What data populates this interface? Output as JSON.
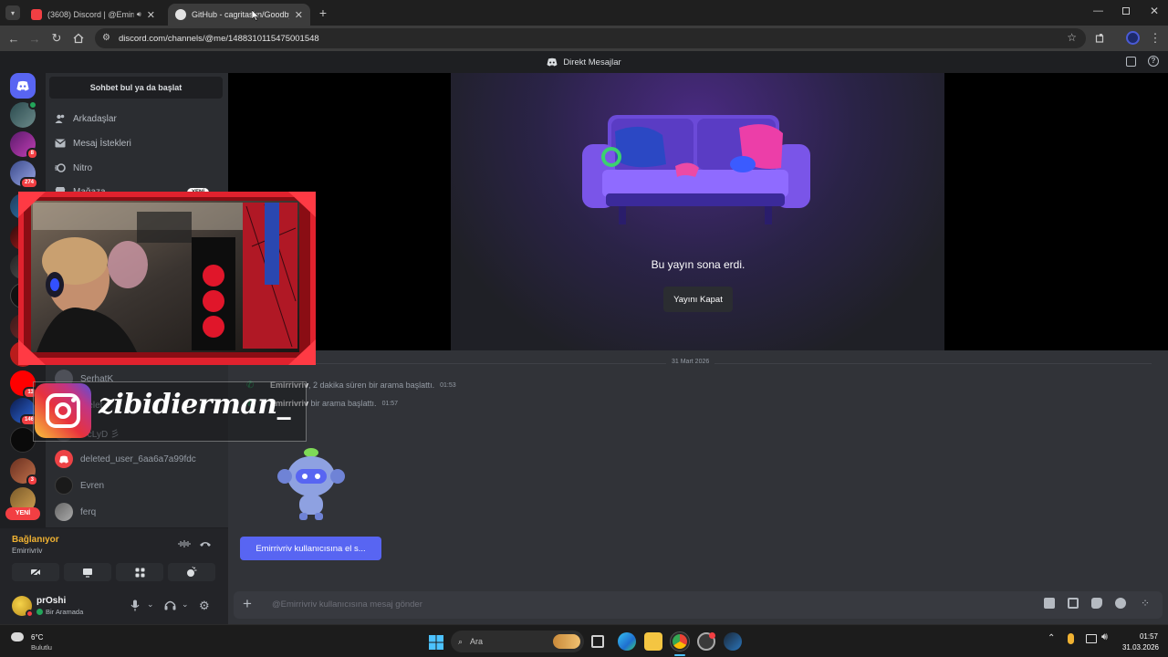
{
  "browser": {
    "tabs": [
      {
        "title": "(3608) Discord | @Emirrivriv",
        "active": false
      },
      {
        "title": "GitHub - cagritaskn/GoodbyeD",
        "active": true
      }
    ],
    "url": "discord.com/channels/@me/1488310115475001548"
  },
  "discord": {
    "window_title": "Direkt Mesajlar",
    "guild_badges": [
      "8",
      "274",
      "1",
      "13",
      "146",
      "3"
    ],
    "new_badge": "YENİ",
    "dm_search": "Sohbet bul ya da başlat",
    "nav": [
      {
        "label": "Arkadaşlar",
        "icon": "friends-icon"
      },
      {
        "label": "Mesaj İstekleri",
        "icon": "mail-icon"
      },
      {
        "label": "Nitro",
        "icon": "nitro-icon"
      },
      {
        "label": "Mağaza",
        "icon": "shop-icon",
        "badge": "YENİ"
      }
    ],
    "dm_users": [
      "SerhatK",
      "deleted_user_6aa6a7a99fdc",
      "Evren",
      "ferq"
    ],
    "dm_partial": [
      "...",
      "...elet",
      "z cLyD 彡"
    ],
    "voice": {
      "status": "Bağlanıyor",
      "channel": "Emirrivriv"
    },
    "user": {
      "name": "prOshi",
      "status": "Bir Aramada"
    },
    "stream_ended_text": "Bu yayın sona erdi.",
    "close_stream_label": "Yayını Kapat",
    "date_divider": "31 Mart 2026",
    "messages": [
      {
        "author": "Emirrivriv",
        "text": ", 2 dakika süren bir arama başlattı.",
        "time": "01:53"
      },
      {
        "author": "Emirrivriv",
        "text": " bir arama başlattı.",
        "time": "01:57"
      }
    ],
    "wave_button": "Emirrivriv kullanıcısına el s...",
    "composer_placeholder": "@Emirrivriv kullanıcısına mesaj gönder"
  },
  "overlay": {
    "instagram_handle": "zibidierman_"
  },
  "taskbar": {
    "weather_temp": "6°C",
    "weather_desc": "Bulutlu",
    "search_label": "Ara",
    "time": "01:57",
    "date": "31.03.2026"
  },
  "colors": {
    "discord_blurple": "#5865f2",
    "connecting": "#f0b232",
    "badge_red": "#f23f43",
    "online_green": "#23a55a"
  }
}
